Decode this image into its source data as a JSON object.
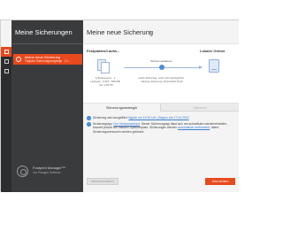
{
  "sidebar": {
    "title": "Meine Sicherungen",
    "item": {
      "name": "Meine neue Sicherung",
      "subtitle": "Tägliche Sicherungsvorgänge · C:\\..."
    },
    "product": {
      "name": "Footprint Manager™",
      "vendor": "von Paragon Software"
    }
  },
  "main": {
    "title": "Meine neue Sicherung",
    "source": {
      "title": "Festplatten/Laufw...",
      "caption": "C:\\Dokumente\\ · 2 Laufwerk · NTFS · 845 MB · frei: 1,65 TB"
    },
    "destination": {
      "title": "Lokaler Ordner"
    },
    "schedule": {
      "label": "Sicherungsdateien",
      "caption": "Letzte Sicherung: noch nicht durchgeführt · Nächste Sicherung: 20.04.2019 15:30"
    },
    "tabs": [
      "Sicherungsstrategie",
      "Optionen"
    ],
    "info": [
      {
        "prefix": "Sicherung wird ausgeführt",
        "link": "täglich um 15:30 Uhr | Beginn am 17.04.2019"
      },
      {
        "prefix": "Sicherungstyp:",
        "link": "Nur Versionsverlauf",
        "rest": ". Dieser Sicherungstyp lässt sich am schnellsten wiederherstellen, braucht jedoch am meisten Speicherplatz. Sicherungen werden",
        "link2": "automatisch aufbewahrt",
        "rest2": ", ältere Sicherungsversionen werden gelöscht."
      }
    ],
    "buttons": {
      "secondary": "Wiederherstellen",
      "primary": "Jetzt sichern"
    }
  },
  "colors": {
    "accent": "#e8491d",
    "sidebar": "#3a3b3d",
    "link": "#3b7fd0"
  }
}
